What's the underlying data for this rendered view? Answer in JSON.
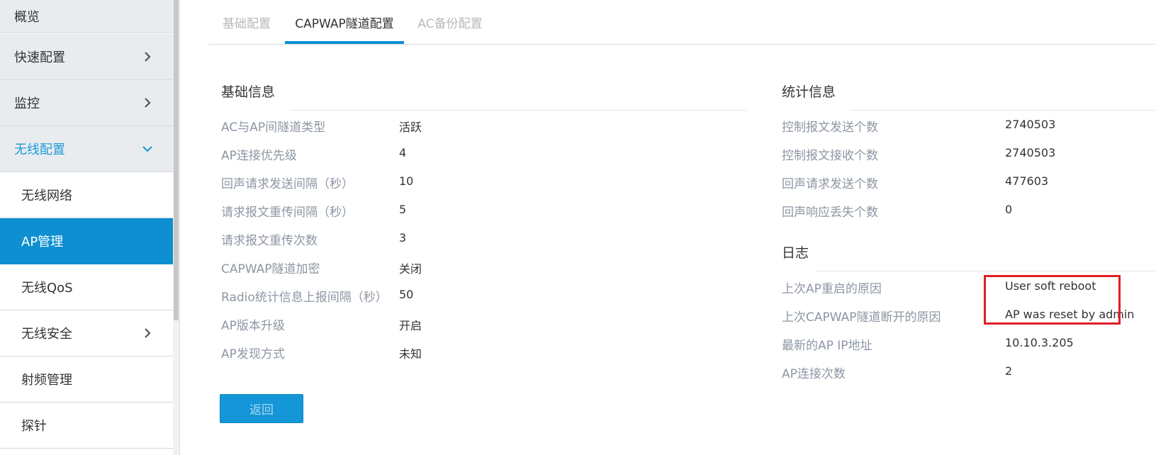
{
  "sidebar": {
    "items": [
      {
        "label": "概览",
        "kind": "top"
      },
      {
        "label": "快速配置",
        "kind": "top",
        "chevron": "chevron-right-icon"
      },
      {
        "label": "监控",
        "kind": "top",
        "chevron": "chevron-right-icon"
      },
      {
        "label": "无线配置",
        "kind": "top-expanded",
        "chevron": "chevron-down-icon"
      },
      {
        "label": "无线网络",
        "kind": "sub"
      },
      {
        "label": "AP管理",
        "kind": "sub-active"
      },
      {
        "label": "无线QoS",
        "kind": "sub"
      },
      {
        "label": "无线安全",
        "kind": "sub",
        "chevron": "chevron-right-icon"
      },
      {
        "label": "射频管理",
        "kind": "sub"
      },
      {
        "label": "探针",
        "kind": "sub"
      }
    ]
  },
  "tabs": [
    {
      "label": "基础配置",
      "active": false
    },
    {
      "label": "CAPWAP隧道配置",
      "active": true
    },
    {
      "label": "AC备份配置",
      "active": false
    }
  ],
  "basic_info": {
    "title": "基础信息",
    "rows": [
      {
        "label": "AC与AP间隧道类型",
        "value": "活跃"
      },
      {
        "label": "AP连接优先级",
        "value": "4"
      },
      {
        "label": "回声请求发送间隔（秒）",
        "value": "10"
      },
      {
        "label": "请求报文重传间隔（秒）",
        "value": "5"
      },
      {
        "label": "请求报文重传次数",
        "value": "3"
      },
      {
        "label": "CAPWAP隧道加密",
        "value": "关闭"
      },
      {
        "label": "Radio统计信息上报间隔（秒）",
        "value": "50"
      },
      {
        "label": "AP版本升级",
        "value": "开启"
      },
      {
        "label": "AP发现方式",
        "value": "未知"
      }
    ]
  },
  "stats_info": {
    "title": "统计信息",
    "rows": [
      {
        "label": "控制报文发送个数",
        "value": "2740503"
      },
      {
        "label": "控制报文接收个数",
        "value": "2740503"
      },
      {
        "label": "回声请求发送个数",
        "value": "477603"
      },
      {
        "label": "回声响应丢失个数",
        "value": "0"
      }
    ]
  },
  "log": {
    "title": "日志",
    "rows": [
      {
        "label": "上次AP重启的原因",
        "value": "User soft reboot"
      },
      {
        "label": "上次CAPWAP隧道断开的原因",
        "value": "AP was reset by admin"
      },
      {
        "label": "最新的AP IP地址",
        "value": "10.10.3.205"
      },
      {
        "label": "AP连接次数",
        "value": "2"
      }
    ]
  },
  "back_button": {
    "label": "返回"
  },
  "colors": {
    "accent": "#0e8fd1",
    "highlight": "#e01f26",
    "label_gray": "#8d96a3"
  }
}
